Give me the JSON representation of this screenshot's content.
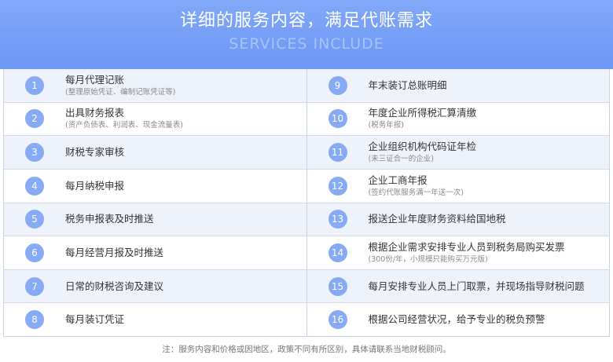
{
  "header": {
    "title": "详细的服务内容，满足代账需求",
    "subtitle": "SERVICES INCLUDE"
  },
  "services": {
    "left": [
      {
        "num": "1",
        "label": "每月代理记账",
        "sub": "(整理原始凭证、编制记账凭证等)"
      },
      {
        "num": "2",
        "label": "出具财务报表",
        "sub": "(资产负债表、利润表、现金流量表)"
      },
      {
        "num": "3",
        "label": "财税专家审核",
        "sub": ""
      },
      {
        "num": "4",
        "label": "每月纳税申报",
        "sub": ""
      },
      {
        "num": "5",
        "label": "税务申报表及时推送",
        "sub": ""
      },
      {
        "num": "6",
        "label": "每月经营月报及时推送",
        "sub": ""
      },
      {
        "num": "7",
        "label": "日常的财税咨询及建议",
        "sub": ""
      },
      {
        "num": "8",
        "label": "每月装订凭证",
        "sub": ""
      }
    ],
    "right": [
      {
        "num": "9",
        "label": "年末装订总账明细",
        "sub": ""
      },
      {
        "num": "10",
        "label": "年度企业所得税汇算清缴",
        "sub": "(税务年报)"
      },
      {
        "num": "11",
        "label": "企业组织机构代码证年检",
        "sub": "(未三证合一的企业)"
      },
      {
        "num": "12",
        "label": "企业工商年报",
        "sub": "(签约代账服务满一年送一次)"
      },
      {
        "num": "13",
        "label": "报送企业年度财务资料给国地税",
        "sub": ""
      },
      {
        "num": "14",
        "label": "根据企业需求安排专业人员到税务局购买发票",
        "sub": "(300份/年，小规模只能购买万元版)"
      },
      {
        "num": "15",
        "label": "每月安排专业人员上门取票，并现场指导财税问题",
        "sub": ""
      },
      {
        "num": "16",
        "label": "根据公司经营状况，给予专业的税负预警",
        "sub": ""
      }
    ]
  },
  "footer": {
    "note": "注：服务内容和价格或因地区，政策不同有所区别，具体请联系当地财税顾问。"
  },
  "colors": {
    "banner": "#7aa1f7",
    "badge": "#87aaf5",
    "row_alt": "#eef3fb"
  }
}
